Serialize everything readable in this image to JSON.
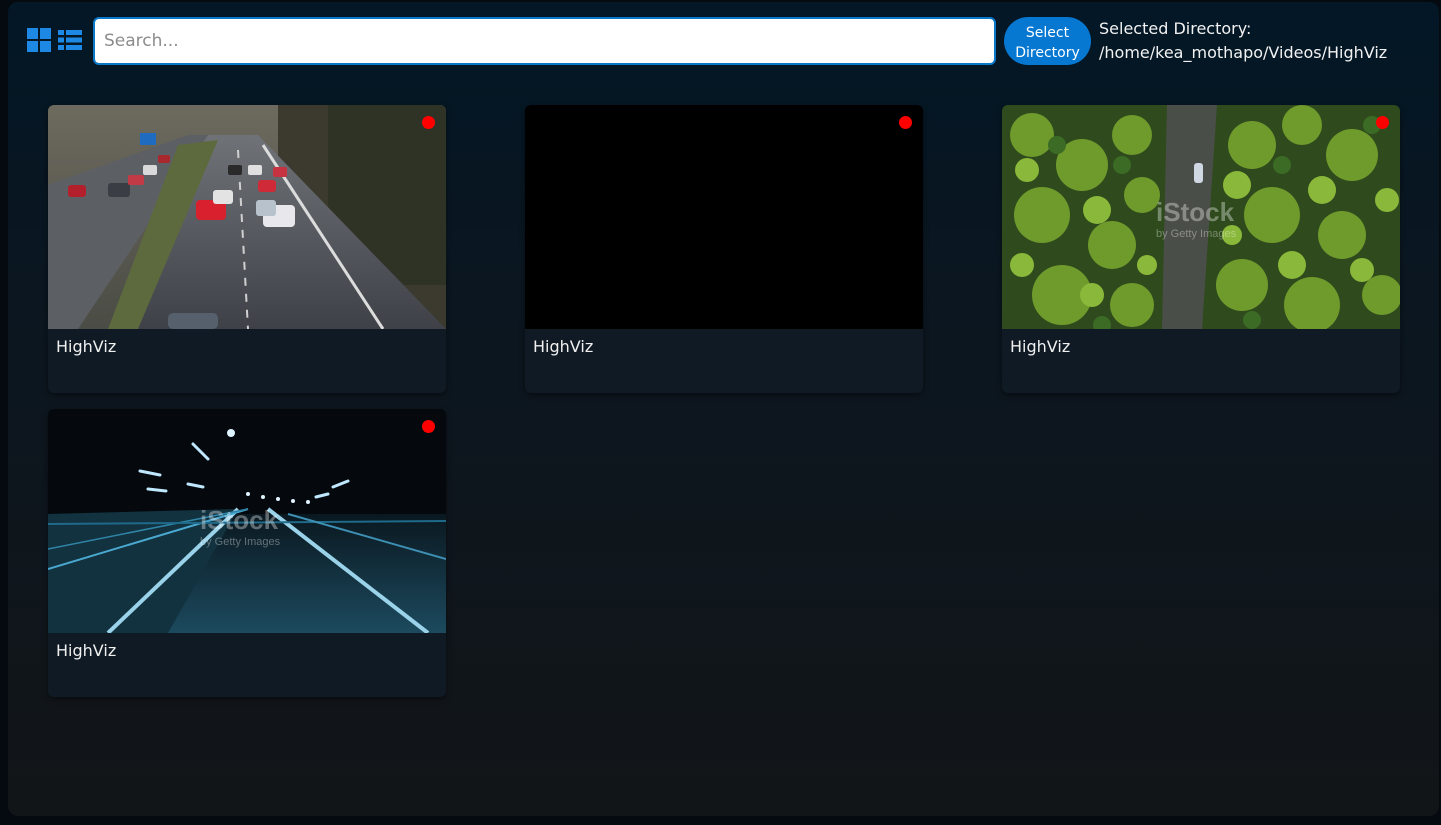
{
  "toolbar": {
    "grid_view_icon": "grid-view-icon",
    "list_view_icon": "list-view-icon",
    "search_placeholder": "Search...",
    "search_value": "",
    "select_button_label": "Select\nDirectory",
    "selected_directory_label": "Selected Directory:",
    "selected_directory_path": "/home/kea_mothapo/Videos/HighViz"
  },
  "colors": {
    "accent": "#0678d2",
    "status_dot": "#ff0000",
    "card_bg": "#0f1a24"
  },
  "videos": [
    {
      "title": "HighViz",
      "status_icon": "record-dot-icon",
      "thumbnail": "highway-traffic"
    },
    {
      "title": "HighViz",
      "status_icon": "record-dot-icon",
      "thumbnail": "black-frame"
    },
    {
      "title": "HighViz",
      "status_icon": "record-dot-icon",
      "thumbnail": "aerial-forest-road",
      "watermark": "iStock",
      "watermark_sub": "by Getty Images"
    },
    {
      "title": "HighViz",
      "status_icon": "record-dot-icon",
      "thumbnail": "night-road-lights",
      "watermark": "iStock",
      "watermark_sub": "by Getty Images"
    }
  ]
}
